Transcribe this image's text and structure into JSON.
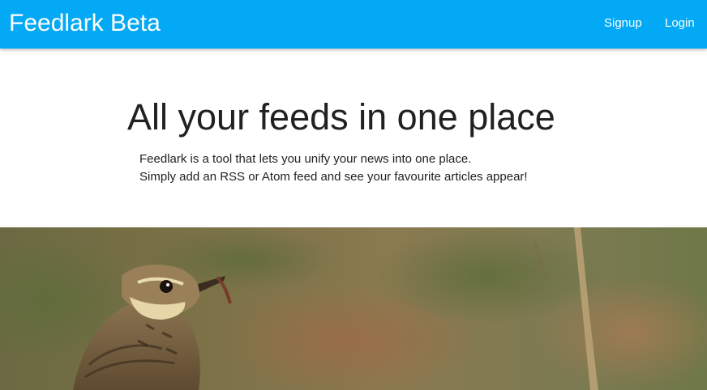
{
  "appbar": {
    "title": "Feedlark Beta",
    "color": "#03a9f4",
    "nav": [
      {
        "label": "Signup"
      },
      {
        "label": "Login"
      }
    ]
  },
  "hero": {
    "title": "All your feeds in one place",
    "lines": [
      "Feedlark is a tool that lets you unify your news into one place.",
      "Simply add an RSS or Atom feed and see your favourite articles appear!"
    ]
  },
  "banner": {
    "image": "bird-photo"
  }
}
